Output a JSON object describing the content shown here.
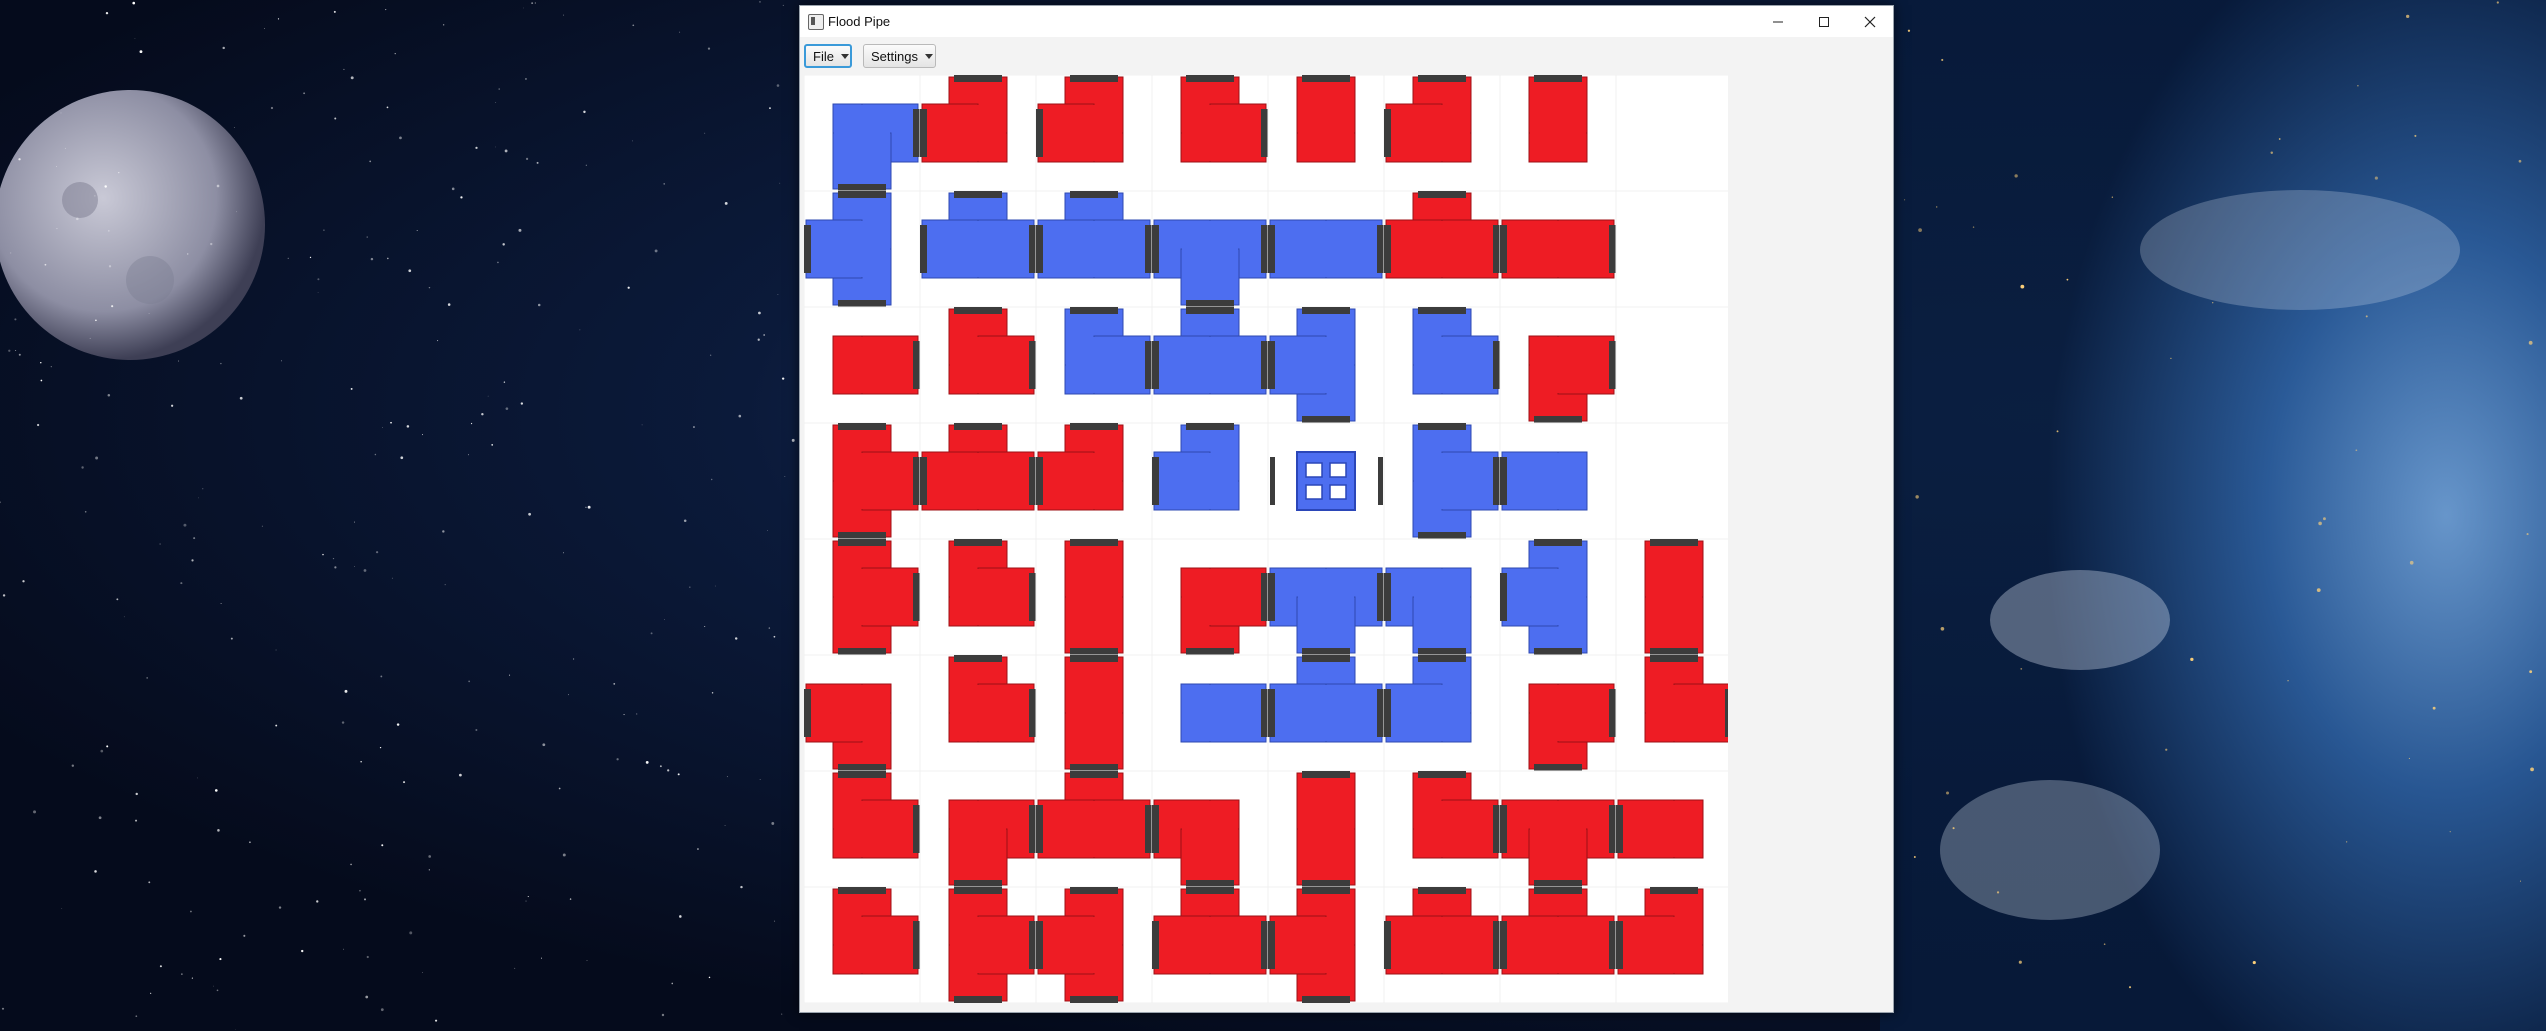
{
  "window": {
    "title": "Flood Pipe"
  },
  "menu": {
    "file_label": "File",
    "settings_label": "Settings"
  },
  "icons": {
    "minimize": "minimize-icon",
    "maximize": "maximize-icon",
    "close": "close-icon",
    "app": "app-icon",
    "dropdown": "chevron-down-icon"
  },
  "colors": {
    "filled": "#4d6ef0",
    "empty": "#ee1c24",
    "connector": "#3c3c3c",
    "board_bg": "#ffffff"
  },
  "board": {
    "rows": 8,
    "cols": 8,
    "source": {
      "row": 3,
      "col": 4
    },
    "tiles": [
      [
        "RD",
        "UL",
        "UL",
        "UR",
        "U",
        "UL",
        "U",
        ""
      ],
      [
        "UDL",
        "URL",
        "URL",
        "LRD",
        "LR",
        "URL",
        "LR",
        ""
      ],
      [
        "R",
        "UR",
        "UR",
        "URL",
        "UDL",
        "UR",
        "DR",
        ""
      ],
      [
        "UDR",
        "URL",
        "UL",
        "UL",
        "",
        "UDR",
        "L",
        ""
      ],
      [
        "UDR",
        "UR",
        "UD",
        "DR",
        "LRD",
        "LD",
        "UDL",
        "UD"
      ],
      [
        "DL",
        "UR",
        "UD",
        "R",
        "URL",
        "UL",
        "DR",
        "UR"
      ],
      [
        "UR",
        "RD",
        "ULR",
        "LD",
        "UD",
        "UR",
        "LRD",
        "L"
      ],
      [
        "UR",
        "UDR",
        "UDL",
        "URL",
        "UDL",
        "URL",
        "URL",
        "UL"
      ]
    ],
    "filled": [
      [
        1,
        0,
        0,
        0,
        0,
        0,
        0,
        0
      ],
      [
        1,
        1,
        1,
        1,
        1,
        0,
        0,
        0
      ],
      [
        0,
        0,
        1,
        1,
        1,
        1,
        0,
        0
      ],
      [
        0,
        0,
        0,
        1,
        1,
        1,
        1,
        1
      ],
      [
        0,
        0,
        0,
        0,
        1,
        1,
        1,
        0
      ],
      [
        0,
        0,
        0,
        1,
        1,
        1,
        0,
        0
      ],
      [
        0,
        0,
        0,
        0,
        0,
        0,
        0,
        0
      ],
      [
        0,
        0,
        0,
        0,
        0,
        0,
        0,
        0
      ]
    ]
  }
}
